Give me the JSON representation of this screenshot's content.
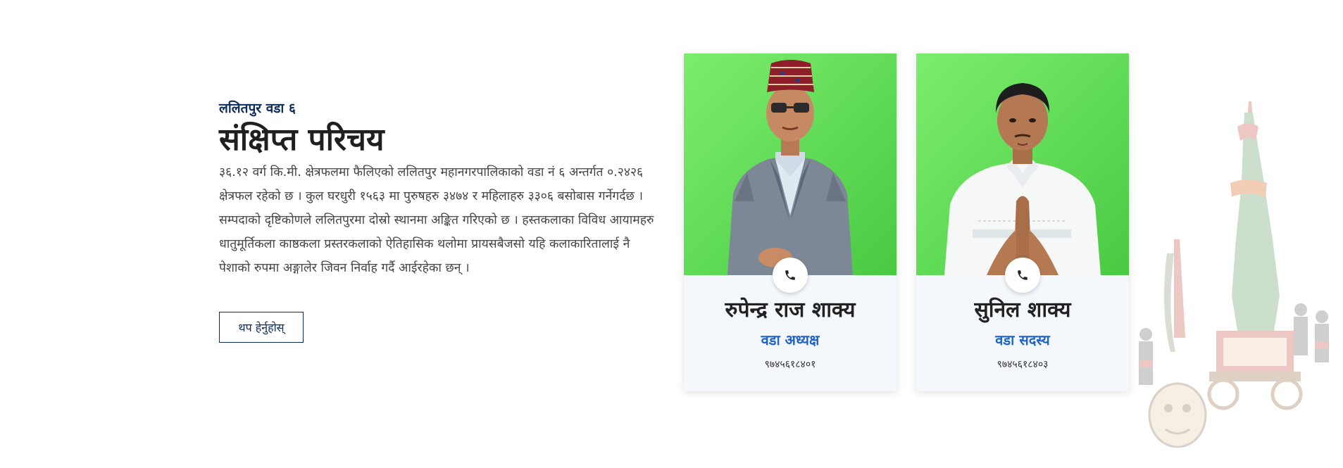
{
  "intro": {
    "eyebrow": "ललितपुर वडा ६",
    "title": "संक्षिप्त परिचय",
    "description": "३६.१२ वर्ग कि.मी. क्षेत्रफलमा फैलिएको ललितपुर महानगरपालिकाको वडा नं ६ अन्तर्गत ०.२४२६ क्षेत्रफल रहेको छ । कुल घरधुरी १५६३ मा पुरुषहरु ३४७४ र महिलाहरु ३३०६ बसोबास गर्नेगर्दछ । सम्पदाको दृष्टिकोणले ललितपुरमा दोस्रो स्थानमा अङ्कित गरिएको छ । हस्तकलाका विविध आयामहरु धातुमूर्तिकला काष्ठकला प्रस्तरकलाको ऐतिहासिक थलोमा प्रायसबैजसो यहि कलाकारितालाई नै पेशाको रुपमा अङ्गालेर जिवन निर्वाह गर्दै आईरहेका छन् ।",
    "more_button": "थप हेर्नुहोस्"
  },
  "members": [
    {
      "name": "रुपेन्द्र राज शाक्य",
      "role": "वडा अध्यक्ष",
      "phone": "९७४५६१८४०१",
      "call_icon": "phone-icon"
    },
    {
      "name": "सुनिल शाक्य",
      "role": "वडा सदस्य",
      "phone": "९७४५६१८४०३",
      "call_icon": "phone-icon"
    }
  ],
  "colors": {
    "brand_navy": "#0d2b5e",
    "role_blue": "#1f63c6",
    "card_bg": "#f4f7fb",
    "photo_green": "#6be261"
  }
}
